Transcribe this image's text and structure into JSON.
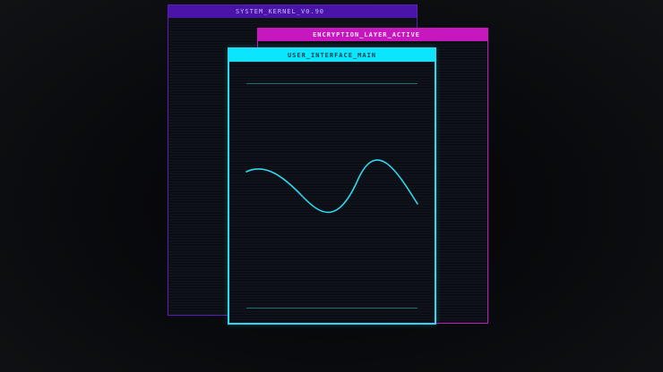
{
  "windows": {
    "kernel": {
      "title": "SYSTEM_KERNEL_V0.90",
      "accent": "#4a14a8"
    },
    "encryption": {
      "title": "ENCRYPTION_LAYER_ACTIVE",
      "accent": "#c718c0"
    },
    "ui": {
      "title": "USER_INTERFACE_MAIN",
      "accent": "#09e6ff"
    }
  },
  "colors": {
    "background": "#08090c",
    "panel": "#0b0e14",
    "wave": "#2ed8f0"
  },
  "icons": []
}
